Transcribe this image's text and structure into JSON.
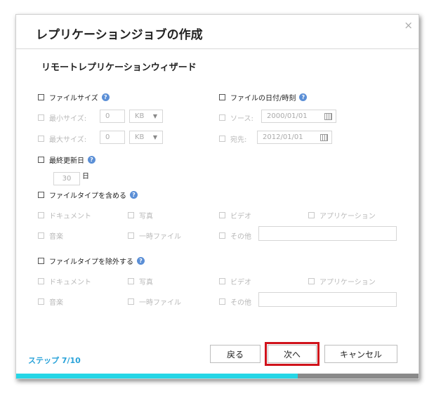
{
  "dialog": {
    "title": "レプリケーションジョブの作成",
    "close_glyph": "×",
    "subtitle": "リモートレプリケーションウィザード"
  },
  "filters": {
    "file_size": {
      "label": "ファイルサイズ",
      "min_label": "最小サイズ:",
      "min_value": "0",
      "min_unit": "KB",
      "max_label": "最大サイズ:",
      "max_value": "0",
      "max_unit": "KB"
    },
    "file_date": {
      "label": "ファイルの日付/時刻",
      "source_label": "ソース:",
      "source_date": "2000/01/01",
      "dest_label": "宛先:",
      "dest_date": "2012/01/01"
    },
    "last_modified": {
      "label": "最終更新日",
      "value": "30",
      "unit": "日"
    },
    "include_types": {
      "label": "ファイルタイプを含める",
      "items": [
        "ドキュメント",
        "写真",
        "ビデオ",
        "アプリケーション",
        "音楽",
        "一時ファイル",
        "その他"
      ]
    },
    "exclude_types": {
      "label": "ファイルタイプを除外する",
      "items": [
        "ドキュメント",
        "写真",
        "ビデオ",
        "アプリケーション",
        "音楽",
        "一時ファイル",
        "その他"
      ]
    },
    "help_glyph": "?",
    "dropdown_arrow": "▼"
  },
  "footer": {
    "step_label": "ステップ 7/10",
    "back_label": "戻る",
    "next_label": "次へ",
    "cancel_label": "キャンセル",
    "progress_fraction": 0.7,
    "highlight_color": "#d0121b",
    "progress_color": "#25d6e6"
  }
}
